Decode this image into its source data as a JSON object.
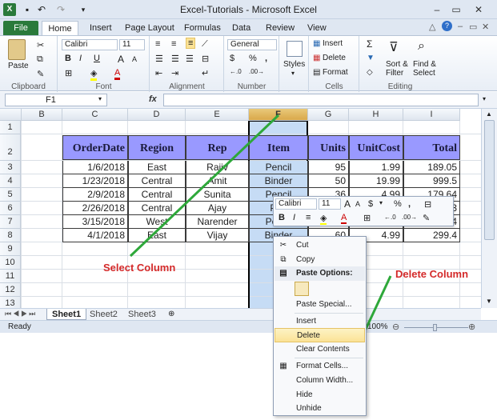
{
  "window": {
    "title": "Excel-Tutorials - Microsoft Excel"
  },
  "tabs": [
    "File",
    "Home",
    "Insert",
    "Page Layout",
    "Formulas",
    "Data",
    "Review",
    "View"
  ],
  "ribbon": {
    "clipboard": {
      "paste": "Paste",
      "label": "Clipboard"
    },
    "font": {
      "name": "Calibri",
      "size": "11",
      "label": "Font",
      "bold": "B",
      "italic": "I",
      "underline": "U",
      "grow": "A",
      "shrink": "A"
    },
    "alignment": {
      "label": "Alignment"
    },
    "number": {
      "format": "General",
      "currency": "$",
      "percent": "%",
      "comma": ",",
      "label": "Number"
    },
    "styles": {
      "label": "Styles"
    },
    "cells": {
      "insert": "Insert",
      "delete": "Delete",
      "format": "Format",
      "label": "Cells"
    },
    "editing": {
      "sum": "Σ",
      "sort": "Sort &",
      "filter": "Filter",
      "find": "Find &",
      "select": "Select",
      "label": "Editing"
    }
  },
  "formula_bar": {
    "name_box": "F1",
    "fx": "fx"
  },
  "columns": [
    "B",
    "C",
    "D",
    "E",
    "F",
    "G",
    "H",
    "I"
  ],
  "rows": [
    "1",
    "2",
    "3",
    "4",
    "5",
    "6",
    "7",
    "8",
    "9",
    "10",
    "11",
    "12",
    "13"
  ],
  "table": {
    "headers": [
      "OrderDate",
      "Region",
      "Rep",
      "Item",
      "Units",
      "UnitCost",
      "Total"
    ],
    "rows": [
      [
        "1/6/2018",
        "East",
        "Rajiv",
        "Pencil",
        "95",
        "1.99",
        "189.05"
      ],
      [
        "1/23/2018",
        "Central",
        "Amit",
        "Binder",
        "50",
        "19.99",
        "999.5"
      ],
      [
        "2/9/2018",
        "Central",
        "Sunita",
        "Pencil",
        "36",
        "4.99",
        "179.64"
      ],
      [
        "2/26/2018",
        "Central",
        "Ajay",
        "Pen",
        "27",
        "19.99",
        "539.73"
      ],
      [
        "3/15/2018",
        "West",
        "Narender",
        "Pencil",
        "56",
        "2.99",
        "167.44"
      ],
      [
        "4/1/2018",
        "East",
        "Vijay",
        "Binder",
        "60",
        "4.99",
        "299.4"
      ]
    ]
  },
  "sheets": [
    "Sheet1",
    "Sheet2",
    "Sheet3"
  ],
  "status": {
    "ready": "Ready",
    "zoom": "100%"
  },
  "mini_toolbar": {
    "font": "Calibri",
    "size": "11",
    "bold": "B",
    "italic": "I",
    "currency": "$",
    "percent": "%",
    "comma": ","
  },
  "context_menu": {
    "items": [
      "Cut",
      "Copy",
      "Paste Options:",
      "Paste Special...",
      "Insert",
      "Delete",
      "Clear Contents",
      "Format Cells...",
      "Column Width...",
      "Hide",
      "Unhide"
    ]
  },
  "annotations": {
    "select": "Select Column",
    "delete": "Delete Column"
  },
  "colors": {
    "header_fill": "#9999ff",
    "selected_col": "#c6dcf5",
    "arrow": "#2ea83a",
    "annotation": "#d42a2a",
    "file_tab": "#2a7a3b",
    "highlight": "#fbe296"
  }
}
